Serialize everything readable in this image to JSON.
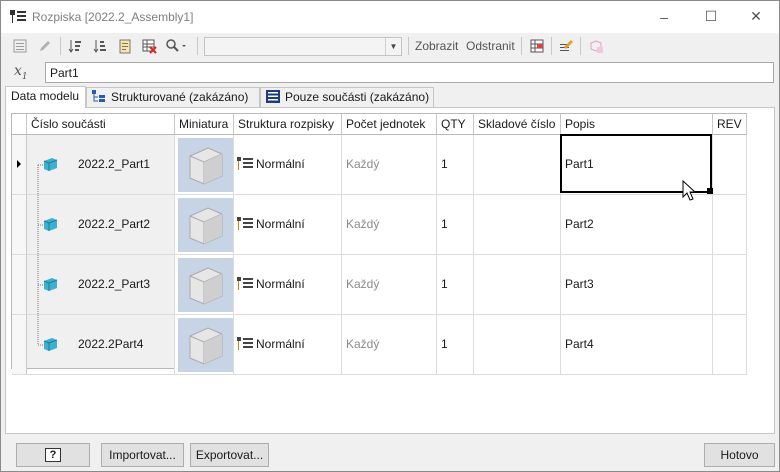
{
  "window": {
    "title": "Rozpiska [2022.2_Assembly1]",
    "minimize": "–",
    "maximize": "☐",
    "close": "✕"
  },
  "toolbar": {
    "combo_value": "",
    "show_label": "Zobrazit",
    "remove_label": "Odstranit"
  },
  "formula": {
    "icon": "x-sub-icon",
    "value": "Part1"
  },
  "tabs": [
    {
      "label": "Data modelu"
    },
    {
      "label": "Strukturované (zakázáno)"
    },
    {
      "label": "Pouze součásti (zakázáno)"
    }
  ],
  "columns": [
    "Číslo součásti",
    "Miniatura",
    "Struktura rozpisky",
    "Počet jednotek",
    "QTY",
    "Skladové číslo",
    "Popis",
    "REV"
  ],
  "rows": [
    {
      "part": "2022.2_Part1",
      "structure": "Normální",
      "unit": "Každý",
      "qty": "1",
      "stock": "",
      "desc": "Part1",
      "rev": ""
    },
    {
      "part": "2022.2_Part2",
      "structure": "Normální",
      "unit": "Každý",
      "qty": "1",
      "stock": "",
      "desc": "Part2",
      "rev": ""
    },
    {
      "part": "2022.2_Part3",
      "structure": "Normální",
      "unit": "Každý",
      "qty": "1",
      "stock": "",
      "desc": "Part3",
      "rev": ""
    },
    {
      "part": "2022.2Part4",
      "structure": "Normální",
      "unit": "Každý",
      "qty": "1",
      "stock": "",
      "desc": "Part4",
      "rev": ""
    }
  ],
  "footer": {
    "help": "?",
    "import": "Importovat...",
    "export": "Exportovat...",
    "done": "Hotovo"
  },
  "colors": {
    "accent_frame": "#000000",
    "thumb_bg": "#c6d4e6",
    "part_cyan": "#3cb0d0"
  }
}
